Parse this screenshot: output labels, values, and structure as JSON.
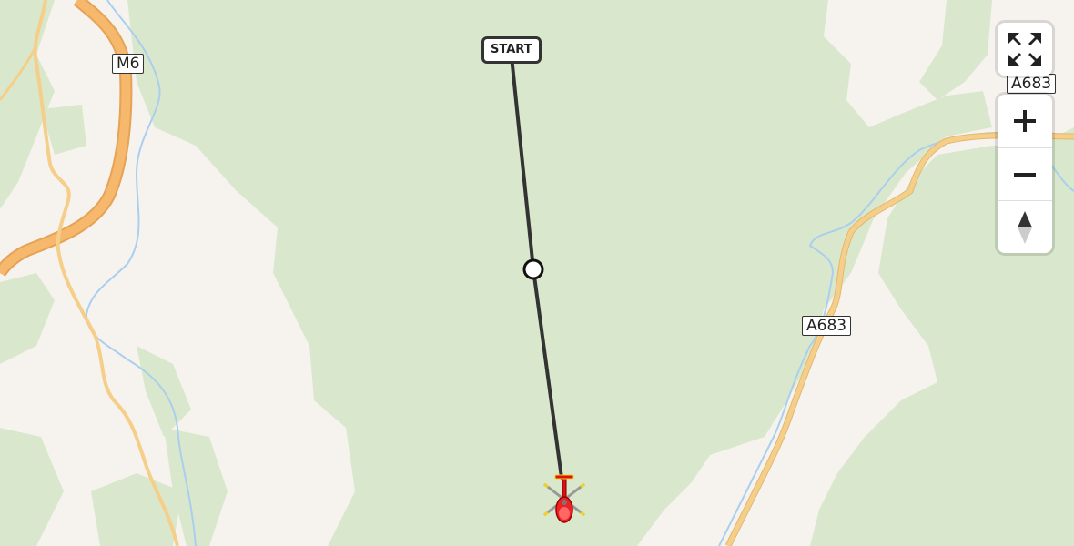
{
  "map": {
    "colors": {
      "land": "#f6f3ef",
      "forest": "#d9e8cc",
      "forest_dark": "#cfe2c0",
      "motorway": "#f5b86c",
      "primary": "#f5cf8a",
      "water": "#aacfee",
      "route": "#333333"
    },
    "road_labels": [
      {
        "id": "m6",
        "text": "M6"
      },
      {
        "id": "a683-top",
        "text": "A683"
      },
      {
        "id": "a683-mid",
        "text": "A683"
      }
    ],
    "route": {
      "start_label": "START",
      "waypoint_icon": "circle-waypoint-icon",
      "vehicle_icon": "helicopter-icon"
    }
  },
  "controls": {
    "fullscreen_icon": "fullscreen-icon",
    "zoom_in_icon": "plus-icon",
    "zoom_out_icon": "minus-icon",
    "compass_icon": "compass-north-icon"
  }
}
